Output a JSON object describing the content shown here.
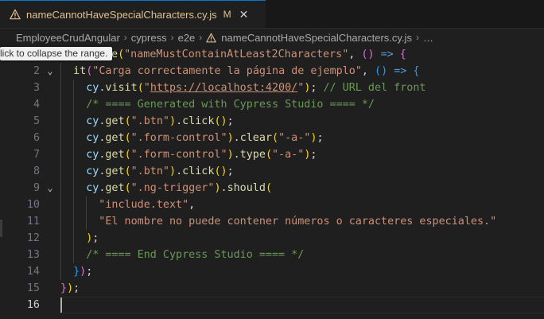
{
  "tab": {
    "title": "nameCannotHaveSpecialCharacters.cy.js",
    "status": "M",
    "close": "✕"
  },
  "breadcrumb": {
    "items": [
      "EmployeeCrudAngular",
      "cypress",
      "e2e",
      "nameCannotHaveSpecialCharacters.cy.js"
    ],
    "ellipsis": "…",
    "separator": "›"
  },
  "tooltip": {
    "text": "lick to collapse the range."
  },
  "editor": {
    "active_line": 16,
    "lines": [
      {
        "n": "",
        "tokens": [
          [
            "pu",
            ""
          ]
        ]
      },
      {
        "n": "2",
        "tokens": [
          [
            "kw",
            "it"
          ],
          [
            "b2",
            "("
          ],
          [
            "str",
            "\"Carga correctamente la página de ejemplo\""
          ],
          [
            "pu",
            ", "
          ],
          [
            "b3",
            "()"
          ],
          [
            "pu",
            " "
          ],
          [
            "ar",
            "=>"
          ],
          [
            "pu",
            " "
          ],
          [
            "b3",
            "{"
          ]
        ]
      },
      {
        "n": "3",
        "tokens": [
          [
            "id",
            "cy"
          ],
          [
            "pu",
            "."
          ],
          [
            "fn",
            "visit"
          ],
          [
            "b1",
            "("
          ],
          [
            "str",
            "\""
          ],
          [
            "str",
            "https://localhost:4200/"
          ],
          [
            "str",
            "\""
          ],
          [
            "b1",
            ")"
          ],
          [
            "pu",
            "; "
          ],
          [
            "cm",
            "// URL del front"
          ]
        ]
      },
      {
        "n": "4",
        "tokens": [
          [
            "cm",
            "/* ==== Generated with Cypress Studio ==== */"
          ]
        ]
      },
      {
        "n": "5",
        "tokens": [
          [
            "id",
            "cy"
          ],
          [
            "pu",
            "."
          ],
          [
            "fn",
            "get"
          ],
          [
            "b1",
            "("
          ],
          [
            "str",
            "\".btn\""
          ],
          [
            "b1",
            ")"
          ],
          [
            "pu",
            "."
          ],
          [
            "fn",
            "click"
          ],
          [
            "b1",
            "()"
          ],
          [
            "pu",
            ";"
          ]
        ]
      },
      {
        "n": "6",
        "tokens": [
          [
            "id",
            "cy"
          ],
          [
            "pu",
            "."
          ],
          [
            "fn",
            "get"
          ],
          [
            "b1",
            "("
          ],
          [
            "str",
            "\".form-control\""
          ],
          [
            "b1",
            ")"
          ],
          [
            "pu",
            "."
          ],
          [
            "fn",
            "clear"
          ],
          [
            "b1",
            "("
          ],
          [
            "str",
            "\"-a-\""
          ],
          [
            "b1",
            ")"
          ],
          [
            "pu",
            ";"
          ]
        ]
      },
      {
        "n": "7",
        "tokens": [
          [
            "id",
            "cy"
          ],
          [
            "pu",
            "."
          ],
          [
            "fn",
            "get"
          ],
          [
            "b1",
            "("
          ],
          [
            "str",
            "\".form-control\""
          ],
          [
            "b1",
            ")"
          ],
          [
            "pu",
            "."
          ],
          [
            "fn",
            "type"
          ],
          [
            "b1",
            "("
          ],
          [
            "str",
            "\"-a-\""
          ],
          [
            "b1",
            ")"
          ],
          [
            "pu",
            ";"
          ]
        ]
      },
      {
        "n": "8",
        "tokens": [
          [
            "id",
            "cy"
          ],
          [
            "pu",
            "."
          ],
          [
            "fn",
            "get"
          ],
          [
            "b1",
            "("
          ],
          [
            "str",
            "\".btn\""
          ],
          [
            "b1",
            ")"
          ],
          [
            "pu",
            "."
          ],
          [
            "fn",
            "click"
          ],
          [
            "b1",
            "()"
          ],
          [
            "pu",
            ";"
          ]
        ]
      },
      {
        "n": "9",
        "tokens": [
          [
            "id",
            "cy"
          ],
          [
            "pu",
            "."
          ],
          [
            "fn",
            "get"
          ],
          [
            "b1",
            "("
          ],
          [
            "str",
            "\".ng-trigger\""
          ],
          [
            "b1",
            ")"
          ],
          [
            "pu",
            "."
          ],
          [
            "fn",
            "should"
          ],
          [
            "b1",
            "("
          ]
        ]
      },
      {
        "n": "10",
        "tokens": [
          [
            "str",
            "\"include.text\""
          ],
          [
            "pu",
            ","
          ]
        ]
      },
      {
        "n": "11",
        "tokens": [
          [
            "str",
            "\"El nombre no puede contener números o caracteres especiales.\""
          ]
        ]
      },
      {
        "n": "12",
        "tokens": [
          [
            "b1",
            ")"
          ],
          [
            "pu",
            ";"
          ]
        ]
      },
      {
        "n": "13",
        "tokens": [
          [
            "cm",
            "/* ==== End Cypress Studio ==== */"
          ]
        ]
      },
      {
        "n": "14",
        "tokens": [
          [
            "b3",
            "}"
          ],
          [
            "b2",
            ")"
          ],
          [
            "pu",
            ";"
          ]
        ]
      },
      {
        "n": "15",
        "tokens": [
          [
            "b2",
            "}"
          ],
          [
            "b1",
            ")"
          ],
          [
            "pu",
            ";"
          ]
        ]
      },
      {
        "n": "16",
        "tokens": [
          [
            "pu",
            ""
          ]
        ]
      }
    ],
    "line1_visible": [
      [
        "fn",
        "e"
      ],
      [
        "b1",
        "("
      ],
      [
        "str",
        "\"nameMustContainAtLeast2Characters\""
      ],
      [
        "pu",
        ", "
      ],
      [
        "b2",
        "()"
      ],
      [
        "pu",
        " "
      ],
      [
        "ar",
        "=>"
      ],
      [
        "pu",
        " "
      ],
      [
        "b2",
        "{"
      ]
    ]
  },
  "icons": [
    "warning-icon",
    "chevron-down-icon"
  ]
}
